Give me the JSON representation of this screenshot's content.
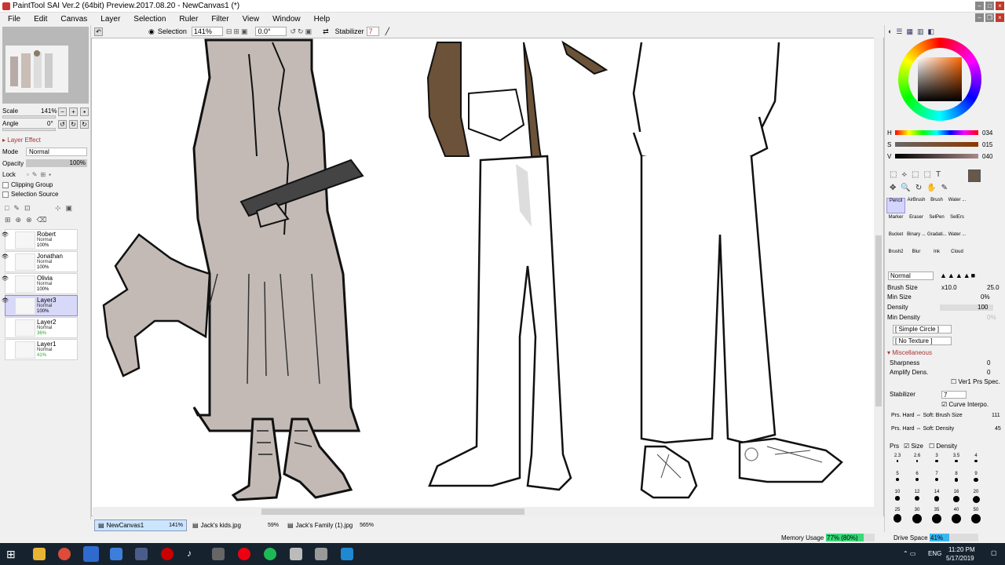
{
  "window": {
    "title": "PaintTool SAI Ver.2 (64bit) Preview.2017.08.20 - NewCanvas1 (*)"
  },
  "menu": [
    "File",
    "Edit",
    "Canvas",
    "Layer",
    "Selection",
    "Ruler",
    "Filter",
    "View",
    "Window",
    "Help"
  ],
  "toolbar": {
    "selection_label": "Selection",
    "zoom": "141%",
    "angle": "0.0°",
    "stabilizer_label": "Stabilizer",
    "stabilizer_value": "7"
  },
  "left": {
    "scale_label": "Scale",
    "scale_value": "141%",
    "angle_label": "Angle",
    "angle_value": "0°",
    "layer_effect": "Layer Effect",
    "mode_label": "Mode",
    "mode_value": "Normal",
    "opacity_label": "Opacity",
    "opacity_value": "100%",
    "lock_label": "Lock",
    "clipping_group": "Clipping Group",
    "selection_source": "Selection Source",
    "layers": [
      {
        "name": "Robert",
        "mode": "Normal",
        "opacity": "100%"
      },
      {
        "name": "Jonathan",
        "mode": "Normal",
        "opacity": "100%"
      },
      {
        "name": "Olivia",
        "mode": "Normal",
        "opacity": "100%"
      },
      {
        "name": "Layer3",
        "mode": "Normal",
        "opacity": "100%"
      },
      {
        "name": "Layer2",
        "mode": "Normal",
        "opacity": "36%"
      },
      {
        "name": "Layer1",
        "mode": "Normal",
        "opacity": "41%"
      }
    ]
  },
  "tabs": [
    {
      "name": "NewCanvas1",
      "zoom": "141%"
    },
    {
      "name": "Jack's kids.jpg",
      "zoom": "59%"
    },
    {
      "name": "Jack's Family (1).jpg",
      "zoom": "565%"
    }
  ],
  "right": {
    "h_label": "H",
    "h_value": "034",
    "s_label": "S",
    "s_value": "015",
    "v_label": "V",
    "v_value": "040",
    "current_color": "#66584a",
    "tools": [
      "Pencil",
      "AirBrush",
      "Brush",
      "Water ...",
      "Marker",
      "Eraser",
      "SelPen",
      "SelErs",
      "Bucket",
      "Binary ...",
      "Gradati...",
      "Water ...",
      "Brush2",
      "Blur",
      "Ink",
      "Cloud"
    ],
    "blend_mode": "Normal",
    "brush_size_label": "Brush Size",
    "brush_size_mult": "x10.0",
    "brush_size_value": "25.0",
    "min_size_label": "Min Size",
    "min_size_value": "0%",
    "density_label": "Density",
    "density_value": "100",
    "min_density_label": "Min Density",
    "min_density_value": "0%",
    "shape": "[ Simple Circle ]",
    "texture": "[ No Texture ]",
    "misc_label": "Miscellaneous",
    "sharpness_label": "Sharpness",
    "sharpness_value": "0",
    "amplify_label": "Amplify Dens.",
    "amplify_value": "0",
    "ver1_label": "Ver1 Prs Spec.",
    "stabilizer_label": "Stabilizer",
    "stabilizer_value": "7",
    "curve_label": "Curve Interpo.",
    "prs_size_label": "Prs. Hard ⇔ Soft: Brush Size",
    "prs_size_value": "111",
    "prs_density_label": "Prs. Hard ⇔ Soft: Density",
    "prs_density_value": "45",
    "prs_label": "Prs",
    "size_label": "Size",
    "density_cb_label": "Density",
    "brush_sizes": [
      "2.3",
      "2.6",
      "3",
      "3.5",
      "4",
      "5",
      "6",
      "7",
      "8",
      "9",
      "10",
      "12",
      "14",
      "16",
      "20",
      "25",
      "30",
      "35",
      "40",
      "50"
    ]
  },
  "status": {
    "memory_label": "Memory Usage",
    "memory_value": "77% (80%)",
    "memory_fill": 0.77,
    "drive_label": "Drive Space",
    "drive_value": "41%",
    "drive_fill": 0.41
  },
  "taskbar": {
    "lang": "ENG",
    "time": "11:20 PM",
    "date": "5/17/2019"
  }
}
